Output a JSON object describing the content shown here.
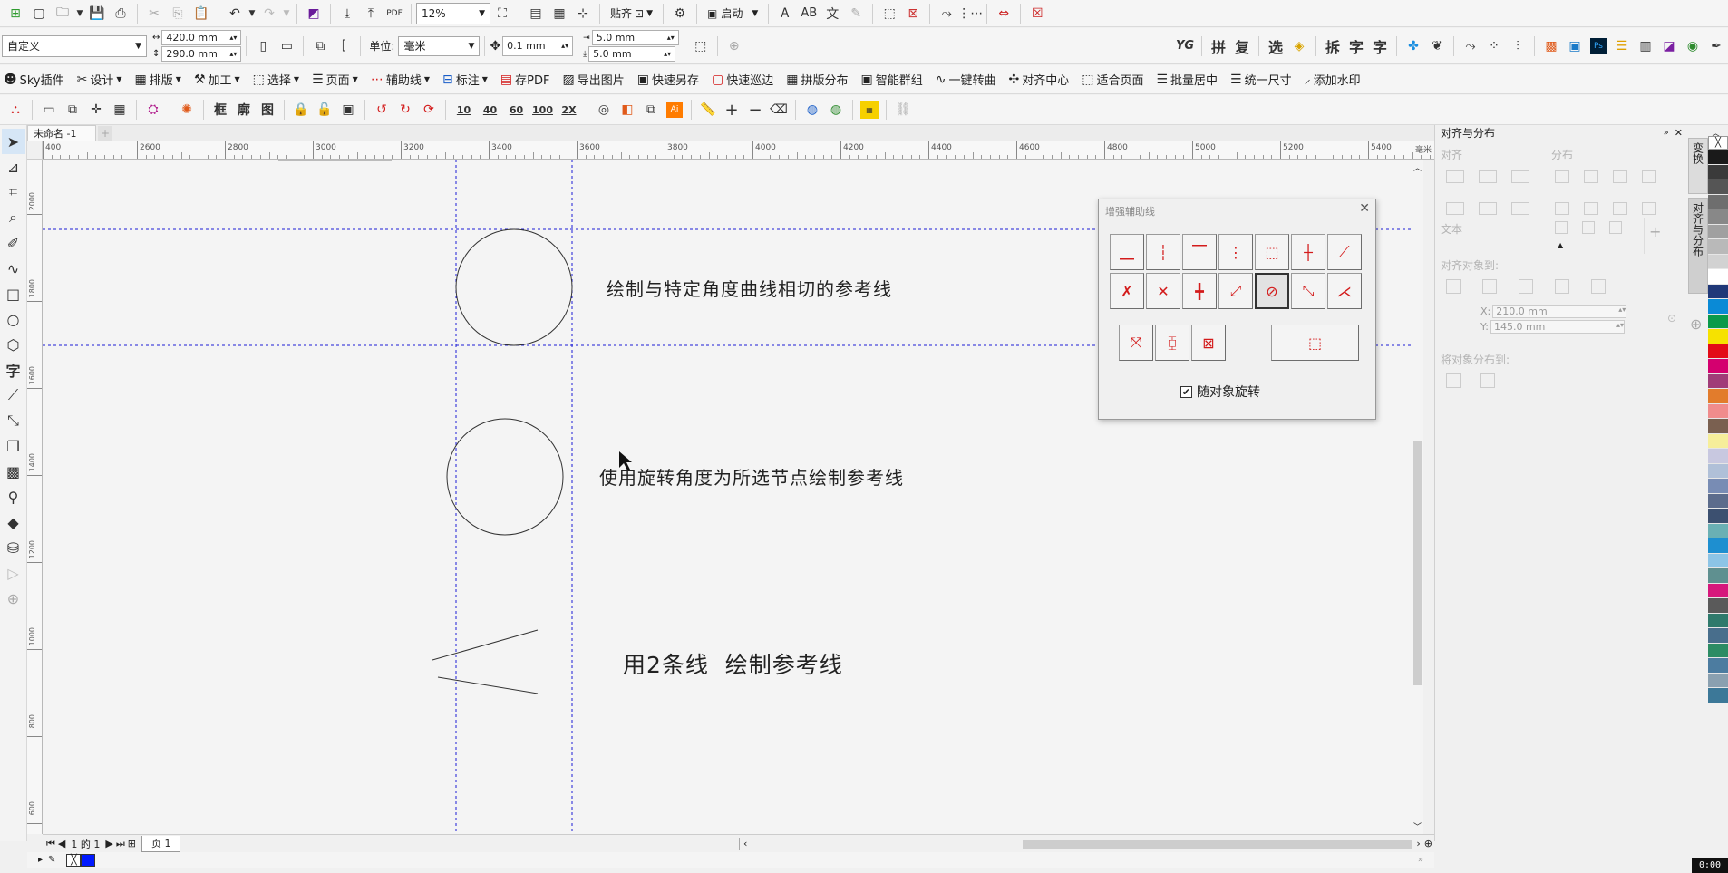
{
  "toolbar1": {
    "zoom": "12%",
    "snap_label": "贴齐",
    "launch_label": "启动",
    "pdf_label": "PDF"
  },
  "propbar": {
    "page_size": "自定义",
    "width": "420.0 mm",
    "height": "290.0 mm",
    "unit_label": "单位:",
    "unit_value": "毫米",
    "nudge": "0.1 mm",
    "dup_x": "5.0 mm",
    "dup_y": "5.0 mm",
    "right_chars": [
      "拼",
      "复",
      "选",
      "拆",
      "字",
      "字"
    ]
  },
  "plugin_menu": [
    {
      "label": "Sky插件",
      "icon": "skull-icon"
    },
    {
      "label": "设计",
      "icon": "scissors-icon"
    },
    {
      "label": "排版",
      "icon": "grid-icon"
    },
    {
      "label": "加工",
      "icon": "tools-icon"
    },
    {
      "label": "选择",
      "icon": "select-icon"
    },
    {
      "label": "页面",
      "icon": "page-icon"
    },
    {
      "label": "辅助线",
      "icon": "guideline-icon"
    },
    {
      "label": "标注",
      "icon": "dimension-icon"
    },
    {
      "label": "存PDF",
      "icon": "pdf-icon"
    },
    {
      "label": "导出图片",
      "icon": "image-icon"
    },
    {
      "label": "快速另存",
      "icon": "saveas-icon"
    },
    {
      "label": "快速巡边",
      "icon": "outline-icon"
    },
    {
      "label": "拼版分布",
      "icon": "distribute-icon"
    },
    {
      "label": "智能群组",
      "icon": "group-icon"
    },
    {
      "label": "一键转曲",
      "icon": "curve-icon"
    },
    {
      "label": "对齐中心",
      "icon": "center-icon"
    },
    {
      "label": "适合页面",
      "icon": "fit-icon"
    },
    {
      "label": "批量居中",
      "icon": "batch-center-icon"
    },
    {
      "label": "统一尺寸",
      "icon": "uniform-size-icon"
    },
    {
      "label": "添加水印",
      "icon": "watermark-icon"
    }
  ],
  "toolbar4": {
    "chars": [
      "框",
      "廓",
      "图"
    ],
    "nums": [
      "10",
      "40",
      "60",
      "100",
      "2X"
    ]
  },
  "document": {
    "tab_title": "未命名 -1",
    "page_indicator": "1 的 1",
    "page_tab": "页 1"
  },
  "ruler": {
    "h_ticks": [
      "400",
      "2600",
      "2800",
      "3000",
      "3200",
      "3400",
      "3600",
      "3800",
      "4000",
      "4200",
      "4400",
      "4600",
      "4800",
      "5000",
      "5200",
      "5400"
    ],
    "h_unit": "毫米",
    "v_ticks": [
      "2000",
      "1800",
      "1600",
      "1400",
      "1200",
      "1000",
      "800",
      "600"
    ]
  },
  "canvas_text": {
    "label1": "绘制与特定角度曲线相切的参考线",
    "label2": "使用旋转角度为所选节点绘制参考线",
    "label3": "用2条线  绘制参考线"
  },
  "dialog": {
    "title": "增强辅助线",
    "checkbox_label": "随对象旋转",
    "checkbox_checked": true
  },
  "panel": {
    "title": "对齐与分布",
    "align": "对齐",
    "distribute": "分布",
    "text": "文本",
    "align_to": "对齐对象到:",
    "x_label": "X:",
    "x_value": "210.0 mm",
    "y_label": "Y:",
    "y_value": "145.0 mm",
    "distribute_to": "将对象分布到:"
  },
  "side_tabs": [
    "变换",
    "对齐与分布"
  ],
  "status": {
    "time": "0:00"
  },
  "colors": {
    "guide": "#1b1bd6",
    "accent_red": "#d31b1b",
    "fill_swatch": "#0019ff"
  },
  "palette": [
    "#1a1a1a",
    "#3a3a3a",
    "#555555",
    "#6e6e6e",
    "#888888",
    "#a0a0a0",
    "#b9b9b9",
    "#d2d2d2",
    "#ffffff",
    "#203878",
    "#0a8ad6",
    "#0a9a4a",
    "#f6e200",
    "#e30b17",
    "#d4006f",
    "#a03c78",
    "#e27c2c",
    "#f08c8c",
    "#7a6050",
    "#f6ee9a",
    "#c8c8e0",
    "#b0c0d8",
    "#788cb4",
    "#5c6c8c",
    "#3c5070",
    "#6ab0b4",
    "#1e8fd0",
    "#8cc4e6",
    "#5f9090",
    "#d6187c",
    "#5a5a5a",
    "#2f7a6c",
    "#486e8c",
    "#2c8c64",
    "#4c7ca0",
    "#8aa0b0",
    "#3c7898"
  ]
}
